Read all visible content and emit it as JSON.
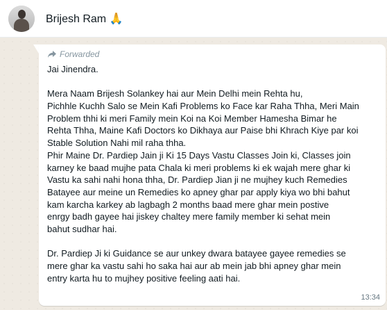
{
  "header": {
    "contact_name": "Brijesh Ram 🙏"
  },
  "message": {
    "forwarded_label": "Forwarded",
    "lines": [
      "Jai Jinendra.",
      "",
      "Mera Naam Brijesh Solankey hai aur Mein Delhi mein Rehta hu,",
      "Pichhle Kuchh Salo se Mein Kafi Problems ko Face kar Raha Thha, Meri Main",
      "Problem thhi ki meri Family mein Koi na Koi Member Hamesha Bimar he",
      "Rehta Thha, Maine Kafi Doctors ko Dikhaya aur Paise bhi Khrach Kiye par koi",
      "Stable Solution Nahi mil raha thha.",
      "Phir Maine Dr. Pardiep Jain ji Ki 15 Days Vastu Classes Join ki, Classes join",
      "karney ke baad mujhe pata Chala ki meri problems ki ek wajah mere ghar ki",
      "Vastu ka sahi nahi hona thha, Dr. Pardiep Jian ji ne mujhey kuch Remedies",
      "Batayee aur meine un Remedies ko apney ghar par apply kiya wo bhi bahut",
      "kam karcha karkey ab lagbagh 2 months baad mere ghar mein postive",
      "enrgy badh gayee hai jiskey chaltey mere family member ki sehat mein",
      "bahut sudhar hai.",
      "",
      "Dr. Pardiep Ji ki Guidance se aur unkey dwara batayee gayee remedies se",
      "mere ghar ka vastu sahi ho saka hai aur ab mein jab bhi apney ghar mein",
      "entry karta hu to mujhey positive feeling aati hai."
    ],
    "timestamp": "13:34"
  },
  "icons": {
    "avatar": "contact-photo",
    "forwarded": "forward-arrow-icon"
  }
}
